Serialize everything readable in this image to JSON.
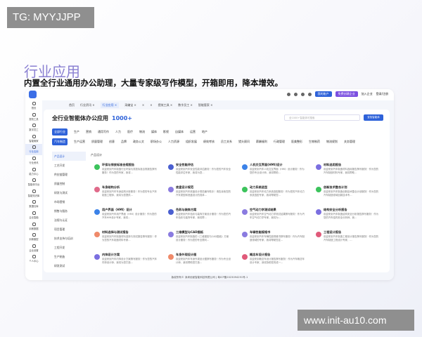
{
  "watermarks": {
    "top_left": "TG: MYYJJPP",
    "bottom_right": "www.init-au10.com"
  },
  "hero": {
    "title": "行业应用",
    "subtitle": "内置全行业通用办公助理，大量专家级写作模型，开箱即用，降本增效。"
  },
  "topbar": {
    "my_account": "我的账户",
    "create_enterprise": "免费创建企业",
    "join_enterprise": "加入企业",
    "login": "登录/注册",
    "colors": {
      "primary": "#2e62d9",
      "purple": "#7b4fe0"
    }
  },
  "tabs": [
    {
      "label": "首页"
    },
    {
      "label": "行业资讯 ×"
    },
    {
      "label": "行业应用 ×",
      "active": true
    },
    {
      "label": "采编宝 ×"
    },
    {
      "label": "×"
    },
    {
      "label": "×"
    },
    {
      "label": "提效工具 ×"
    },
    {
      "label": "数字员工 ×"
    },
    {
      "label": "智能管家 ×"
    }
  ],
  "sidebar": [
    {
      "label": "首页"
    },
    {
      "label": "提效工具"
    },
    {
      "label": "数字员工"
    },
    {
      "label": "智能管家"
    },
    {
      "label": "行业应用",
      "active": true
    },
    {
      "label": "行业资讯"
    },
    {
      "label": "能力中心"
    },
    {
      "label": "智能体平台"
    },
    {
      "label": "智能知识库"
    },
    {
      "label": "数据仓库"
    },
    {
      "label": "企业智脑"
    },
    {
      "label": "训练数据"
    },
    {
      "label": "训练模型"
    },
    {
      "label": "企业设置"
    },
    {
      "label": "个人中心"
    }
  ],
  "main": {
    "title": "全行业智能体办公应用",
    "count": "1000+",
    "search_placeholder": "全1000+智能体可搜索",
    "search_button": "查找智能体",
    "section": "产品设计"
  },
  "chips1": [
    {
      "label": "全部行业",
      "active": true
    },
    {
      "label": "生产"
    },
    {
      "label": "营销"
    },
    {
      "label": "通用写作"
    },
    {
      "label": "人力"
    },
    {
      "label": "医疗"
    },
    {
      "label": "物流"
    },
    {
      "label": "媒体"
    },
    {
      "label": "影视"
    },
    {
      "label": "自媒体"
    },
    {
      "label": "运营"
    },
    {
      "label": "地产"
    }
  ],
  "chips2": [
    {
      "label": "汽车制造",
      "active": true
    },
    {
      "label": "生产运营"
    },
    {
      "label": "质量管理"
    },
    {
      "label": "创意"
    },
    {
      "label": "品牌"
    },
    {
      "label": "政务公文"
    },
    {
      "label": "职场办公"
    },
    {
      "label": "人力资源"
    },
    {
      "label": "组织发展"
    },
    {
      "label": "绩效考核"
    },
    {
      "label": "员工关系"
    },
    {
      "label": "猎头顾问"
    },
    {
      "label": "薪酬福利"
    },
    {
      "label": "行政管理"
    },
    {
      "label": "医美整形"
    },
    {
      "label": "生物制药"
    },
    {
      "label": "物流规划"
    },
    {
      "label": "关务管理"
    }
  ],
  "left_menu": [
    {
      "label": "产品设计",
      "active": true
    },
    {
      "label": "工艺开发"
    },
    {
      "label": "供应链管理"
    },
    {
      "label": "质量控制"
    },
    {
      "label": "研发与测试"
    },
    {
      "label": "市场营销"
    },
    {
      "label": "销售与服务"
    },
    {
      "label": "法规与认证"
    },
    {
      "label": "项目管理"
    },
    {
      "label": "技术支持与培训"
    },
    {
      "label": "工程开发"
    },
    {
      "label": "生产制造"
    },
    {
      "label": "研发测试"
    }
  ],
  "cards": [
    {
      "title": "环保与排放标准合规报告",
      "desc": "欢迎来到汽车制造行业环保与排放标准合规报告撰写服务！作为您的专家，我将...",
      "color": "#3cc35c"
    },
    {
      "title": "安全性能评估",
      "desc": "欢迎来到汽车安全性能评估服务！作为您的汽车安全性能评估专家，我将为您...",
      "color": "#4a5fd0"
    },
    {
      "title": "人机交互界面(HMI)设计",
      "desc": "欢迎来到汽车人机交互界面（HMI）设计服务！作为您的专业设计师，我将帮助...",
      "color": "#3b82e8"
    },
    {
      "title": "材料选用报告",
      "desc": "欢迎来到汽车制造材料选用报告撰写服务！作为您的汽车制造材料专家，我将帮助...",
      "color": "#7b6fe0"
    },
    {
      "title": "车身结构分析",
      "desc": "欢迎来到汽车车身结构分析服务！作为您的专业汽车制造工程师，我将为您提供...",
      "color": "#e06a8a"
    },
    {
      "title": "底盘设计规范",
      "desc": "欢迎来到汽车底盘设计规范编写助手！请告诉我您的汽车类型和底盘设计的具体...",
      "color": "#8a7be0"
    },
    {
      "title": "动力系统选型",
      "desc": "欢迎来到汽车动力系统选型服务！作为您的汽车动力系统选型专家，我将帮助您...",
      "color": "#3cc35c"
    },
    {
      "title": "创新技术整合计划",
      "desc": "欢迎来到汽车制造创新技术整合计划服务！作为您的汽车制造领域创新技术专...",
      "color": "#3cc35c"
    },
    {
      "title": "用户界面（HMI）设计",
      "desc": "欢迎来到汽车用户界面（HMI）设计服务！作为您的汽车HMI设计专家，我将...",
      "color": "#3b82e8"
    },
    {
      "title": "色彩与装饰方案",
      "desc": "欢迎来到汽车色彩与装饰方案设计服务！作为您的汽车色彩与装饰专家，我将帮...",
      "color": "#4a5fd0"
    },
    {
      "title": "空气动力学测试结果",
      "desc": "欢迎来到汽车空气动力学测试结果撰写服务！作为汽车空气动力学专家，我将为...",
      "color": "#8a7be0"
    },
    {
      "title": "结构安全分析报告",
      "desc": "欢迎来到汽车制造结构安全分析报告撰写服务！作为您的汽车结构安全分析师，我...",
      "color": "#7b6fe0"
    },
    {
      "title": "材料选择与测试报告",
      "desc": "欢迎来到汽车制造材料选择与测试报告撰写服务！作为您的汽车制造材料专家...",
      "color": "#ef8a6a"
    },
    {
      "title": "三维模型与CAD图纸",
      "desc": "欢迎来到汽车制造的《三维模型与CAD图纸》方案设计服务！作为您的专业顾问...",
      "color": "#8a7be0"
    },
    {
      "title": "车辆性能规格书",
      "desc": "欢迎来到汽车车辆性能规格书撰写服务！作为汽车制造领域的专家，我将帮助您定...",
      "color": "#8a7be0"
    },
    {
      "title": "工程设计报告",
      "desc": "欢迎来到汽车制造工程设计报告撰写服务！作为您的汽车制造工程设计专家，...",
      "color": "#e05a7a"
    },
    {
      "title": "内饰设计方案",
      "desc": "欢迎来到汽车内饰设计方案撰写服务！作为您的汽车内饰设计师，我将为您打造...",
      "color": "#7b6fe0"
    },
    {
      "title": "车身外观设计图",
      "desc": "欢迎来到汽车车身外观设计图撰写服务！作为专业设计师，我将帮助您打造...",
      "color": "#ef8a6a"
    },
    {
      "title": "概念车设计报告",
      "desc": "欢迎来到概念车设计报告撰写服务！作为汽车概念车设计专家，我将协助您完成一...",
      "color": "#e05a7a"
    }
  ],
  "footer": "版权所有© 深圳优秘智能科技有限公司 | 粤ICP备2023094291号-1"
}
